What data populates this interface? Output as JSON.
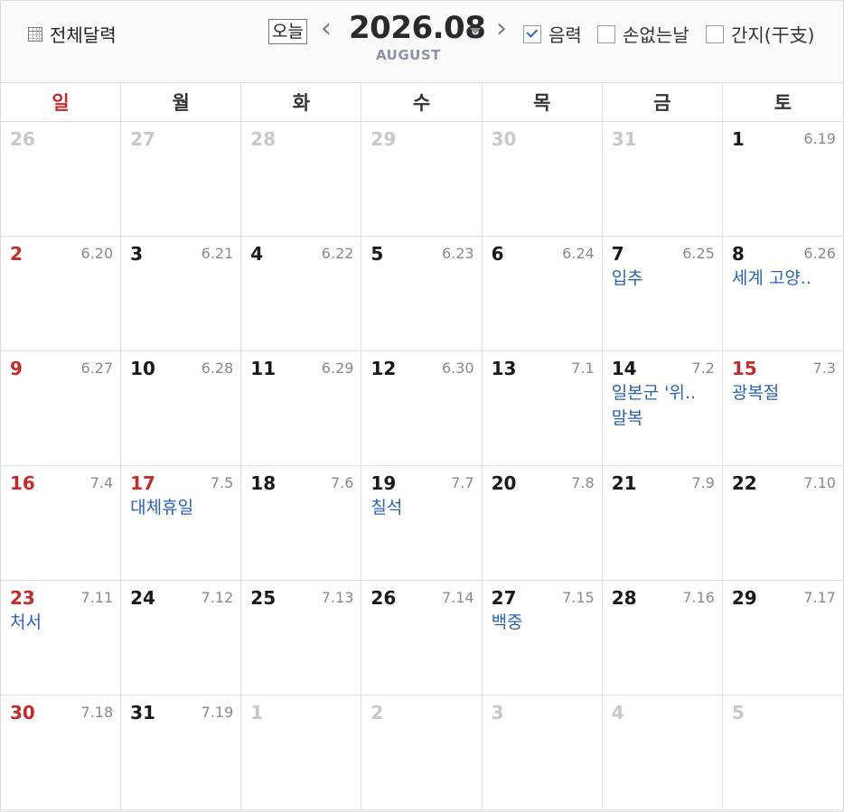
{
  "toolbar": {
    "full_calendar_label": "전체달력",
    "today_label": "오늘",
    "prev_arrow": "‹",
    "next_arrow": "›",
    "month_title": "2026.08",
    "month_sub": "AUGUST",
    "options": {
      "lunar": {
        "label": "음력",
        "checked": true
      },
      "sonop": {
        "label": "손없는날",
        "checked": false
      },
      "ganji": {
        "label": "간지(干支)",
        "checked": false
      }
    }
  },
  "weekdays": [
    "일",
    "월",
    "화",
    "수",
    "목",
    "금",
    "토"
  ],
  "weeks": [
    [
      {
        "day": "26",
        "muted": true
      },
      {
        "day": "27",
        "muted": true
      },
      {
        "day": "28",
        "muted": true
      },
      {
        "day": "29",
        "muted": true
      },
      {
        "day": "30",
        "muted": true
      },
      {
        "day": "31",
        "muted": true
      },
      {
        "day": "1",
        "lunar": "6.19"
      }
    ],
    [
      {
        "day": "2",
        "lunar": "6.20",
        "red": true
      },
      {
        "day": "3",
        "lunar": "6.21"
      },
      {
        "day": "4",
        "lunar": "6.22"
      },
      {
        "day": "5",
        "lunar": "6.23"
      },
      {
        "day": "6",
        "lunar": "6.24"
      },
      {
        "day": "7",
        "lunar": "6.25",
        "events": [
          "입추"
        ]
      },
      {
        "day": "8",
        "lunar": "6.26",
        "events": [
          "세계 고양.."
        ]
      }
    ],
    [
      {
        "day": "9",
        "lunar": "6.27",
        "red": true
      },
      {
        "day": "10",
        "lunar": "6.28"
      },
      {
        "day": "11",
        "lunar": "6.29"
      },
      {
        "day": "12",
        "lunar": "6.30"
      },
      {
        "day": "13",
        "lunar": "7.1"
      },
      {
        "day": "14",
        "lunar": "7.2",
        "events": [
          "일본군 '위..",
          "말복"
        ]
      },
      {
        "day": "15",
        "lunar": "7.3",
        "red": true,
        "events": [
          "광복절"
        ]
      }
    ],
    [
      {
        "day": "16",
        "lunar": "7.4",
        "red": true
      },
      {
        "day": "17",
        "lunar": "7.5",
        "red": true,
        "events": [
          "대체휴일"
        ]
      },
      {
        "day": "18",
        "lunar": "7.6"
      },
      {
        "day": "19",
        "lunar": "7.7",
        "events": [
          "칠석"
        ]
      },
      {
        "day": "20",
        "lunar": "7.8"
      },
      {
        "day": "21",
        "lunar": "7.9"
      },
      {
        "day": "22",
        "lunar": "7.10"
      }
    ],
    [
      {
        "day": "23",
        "lunar": "7.11",
        "red": true,
        "events": [
          "처서"
        ]
      },
      {
        "day": "24",
        "lunar": "7.12"
      },
      {
        "day": "25",
        "lunar": "7.13"
      },
      {
        "day": "26",
        "lunar": "7.14"
      },
      {
        "day": "27",
        "lunar": "7.15",
        "events": [
          "백중"
        ]
      },
      {
        "day": "28",
        "lunar": "7.16"
      },
      {
        "day": "29",
        "lunar": "7.17"
      }
    ],
    [
      {
        "day": "30",
        "lunar": "7.18",
        "red": true
      },
      {
        "day": "31",
        "lunar": "7.19"
      },
      {
        "day": "1",
        "muted": true
      },
      {
        "day": "2",
        "muted": true
      },
      {
        "day": "3",
        "muted": true
      },
      {
        "day": "4",
        "muted": true
      },
      {
        "day": "5",
        "muted": true
      }
    ]
  ],
  "colors": {
    "holiday_red": "#c62b2b",
    "event_blue": "#2a62b8",
    "muted_gray": "#c8c8c8",
    "check_blue": "#3366cc"
  }
}
